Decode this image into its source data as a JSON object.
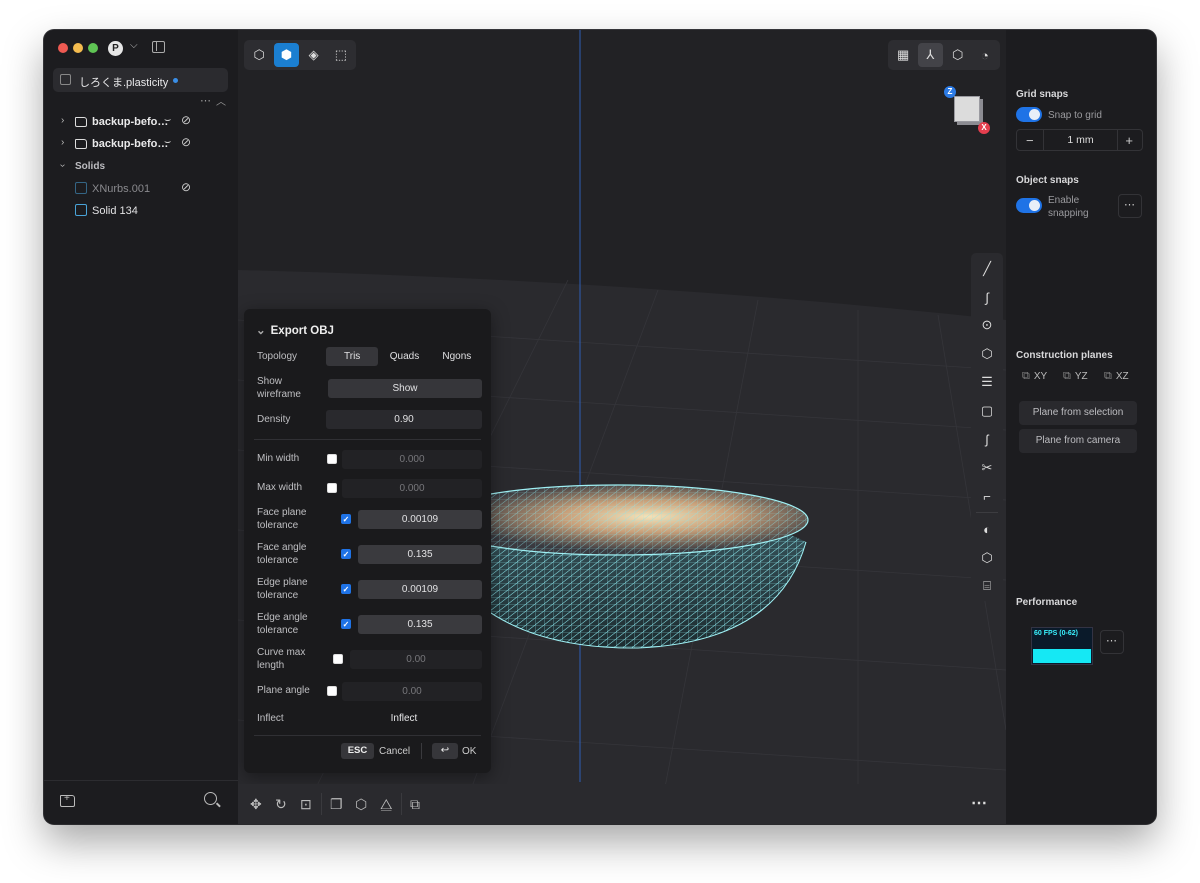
{
  "file_tab": {
    "name": "しろくま.plasticity"
  },
  "tree": {
    "more": "⋯",
    "items": [
      {
        "label": "backup-befo…"
      },
      {
        "label": "backup-befo…"
      },
      {
        "label": "Solids"
      },
      {
        "label": "XNurbs.001"
      },
      {
        "label": "Solid 134"
      }
    ]
  },
  "avatar": "P",
  "export": {
    "title": "Export OBJ",
    "topology": {
      "label": "Topology",
      "options": [
        "Tris",
        "Quads",
        "Ngons"
      ],
      "selected": "Tris"
    },
    "show_wireframe": {
      "label": "Show wireframe",
      "value": "Show"
    },
    "density": {
      "label": "Density",
      "value": "0.90"
    },
    "min_width": {
      "label": "Min width",
      "value": "0.000",
      "checked": false
    },
    "max_width": {
      "label": "Max width",
      "value": "0.000",
      "checked": false
    },
    "face_plane_tolerance": {
      "label": "Face plane tolerance",
      "value": "0.00109",
      "checked": true
    },
    "face_angle_tolerance": {
      "label": "Face angle tolerance",
      "value": "0.135",
      "checked": true
    },
    "edge_plane_tolerance": {
      "label": "Edge plane tolerance",
      "value": "0.00109",
      "checked": true
    },
    "edge_angle_tolerance": {
      "label": "Edge angle tolerance",
      "value": "0.135",
      "checked": true
    },
    "curve_max_length": {
      "label": "Curve max length",
      "value": "0.00",
      "checked": false
    },
    "plane_angle": {
      "label": "Plane angle",
      "value": "0.00",
      "checked": false
    },
    "inflect": {
      "label": "Inflect",
      "value": "Inflect"
    },
    "esc_key": "ESC",
    "cancel": "Cancel",
    "enter_key": "↩",
    "ok": "OK"
  },
  "view_cube": {
    "z": "Z",
    "x": "X"
  },
  "right_panel": {
    "grid_snaps": {
      "title": "Grid snaps",
      "snap_to_grid": "Snap to grid",
      "snap_enabled": true,
      "size": "1 mm",
      "minus": "−",
      "plus": "+"
    },
    "object_snaps": {
      "title": "Object snaps",
      "enable_snapping_line1": "Enable",
      "enable_snapping_line2": "snapping",
      "enabled": true,
      "more": "⋯"
    },
    "construction_planes": {
      "title": "Construction planes",
      "planes": [
        "XY",
        "YZ",
        "XZ"
      ],
      "from_selection": "Plane from selection",
      "from_camera": "Plane from camera"
    },
    "performance": {
      "title": "Performance",
      "fps": "60 FPS (0-62)",
      "more": "⋯"
    }
  },
  "bottom_bar": {
    "more": "⋯"
  },
  "colors": {
    "accent": "#1f73e6",
    "mesh": "#7fe3ea",
    "fps": "#15e8f4"
  }
}
